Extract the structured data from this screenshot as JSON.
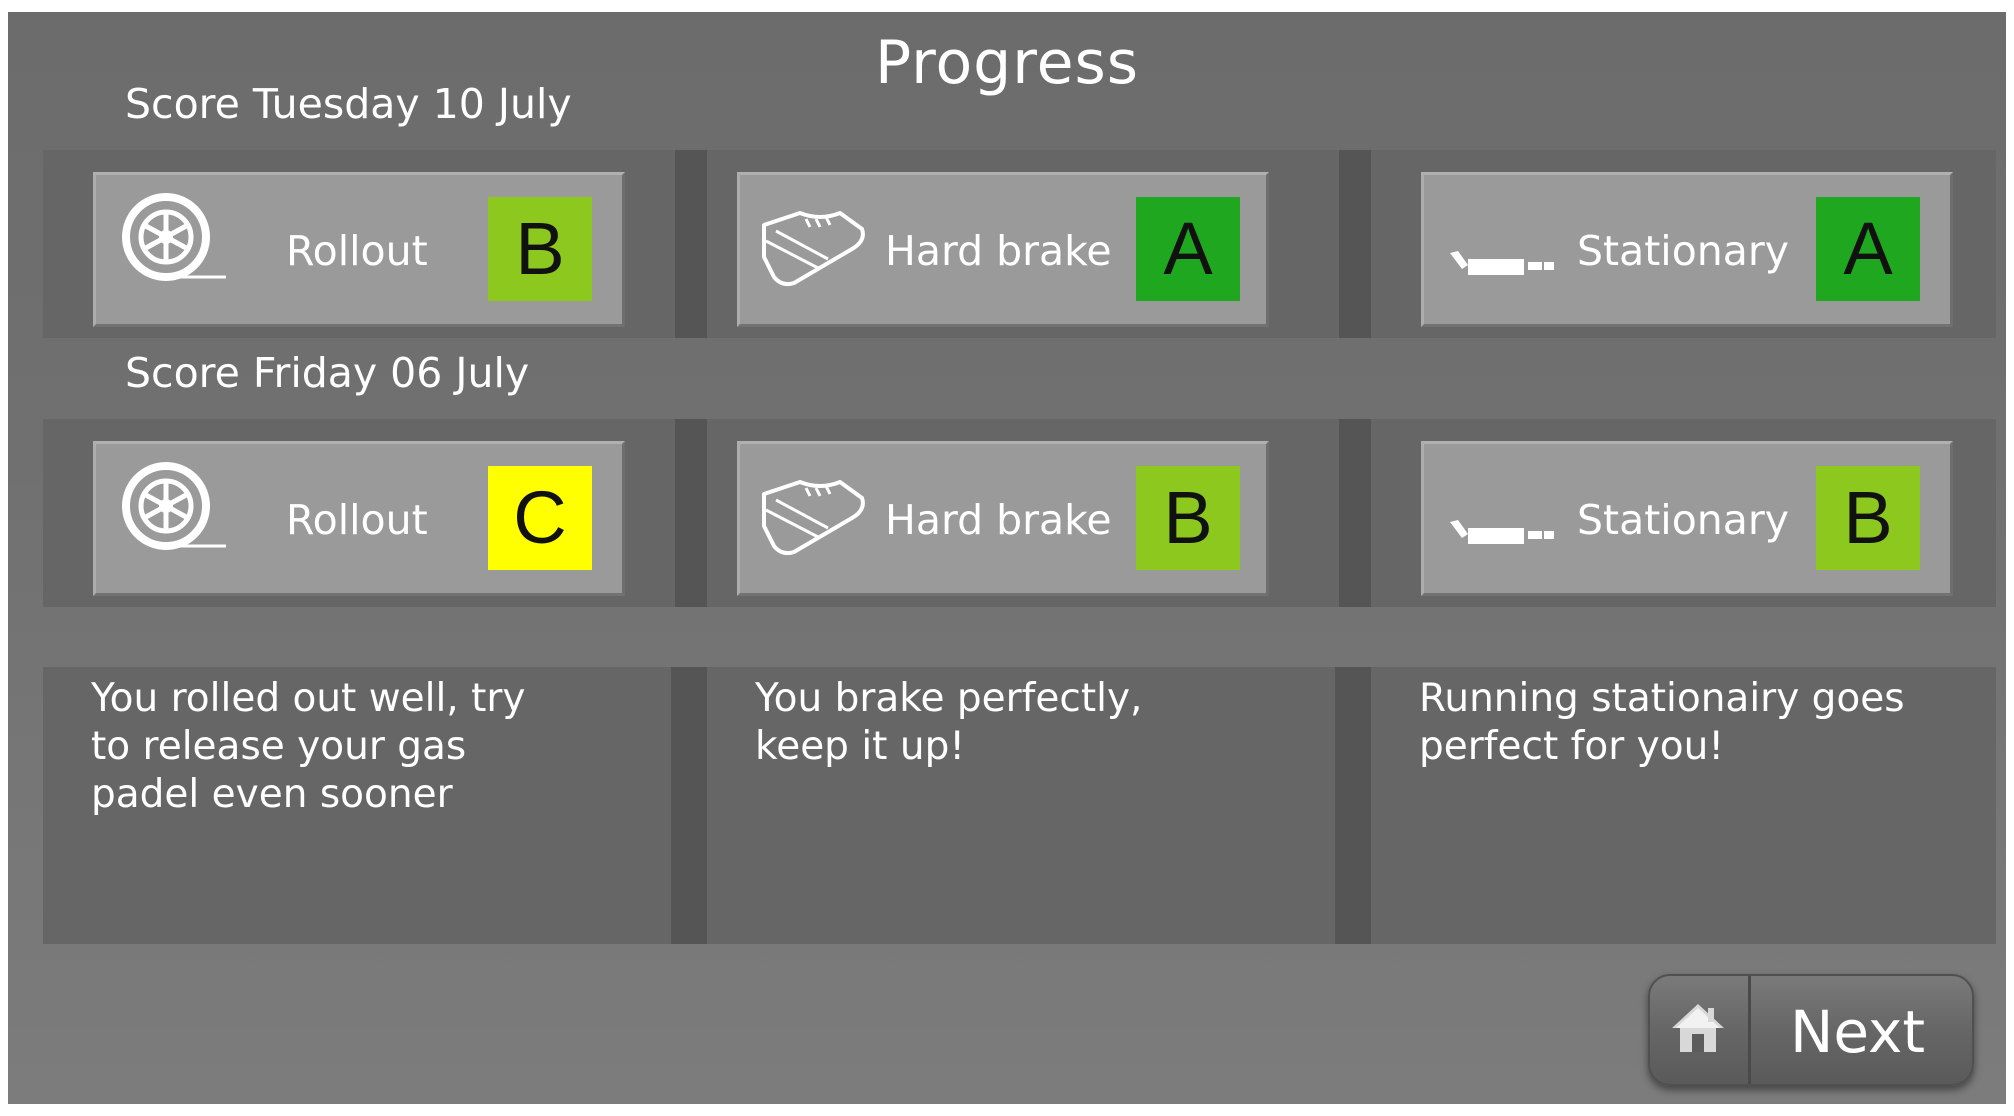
{
  "title": "Progress",
  "sessions": [
    {
      "date_label": "Score Tuesday 10 July",
      "scores": [
        {
          "name": "Rollout",
          "icon": "wheel-icon",
          "grade": "B",
          "grade_color": "#8cc81e"
        },
        {
          "name": "Hard brake",
          "icon": "shoe-icon",
          "grade": "A",
          "grade_color": "#1fa81f"
        },
        {
          "name": "Stationary",
          "icon": "exhaust-icon",
          "grade": "A",
          "grade_color": "#1fa81f"
        }
      ]
    },
    {
      "date_label": "Score Friday 06 July",
      "scores": [
        {
          "name": "Rollout",
          "icon": "wheel-icon",
          "grade": "C",
          "grade_color": "#ffff00"
        },
        {
          "name": "Hard brake",
          "icon": "shoe-icon",
          "grade": "B",
          "grade_color": "#8cc81e"
        },
        {
          "name": "Stationary",
          "icon": "exhaust-icon",
          "grade": "B",
          "grade_color": "#8cc81e"
        }
      ]
    }
  ],
  "feedback": [
    "You rolled out well, try\nto release your gas\npadel even sooner",
    "You brake perfectly,\nkeep it up!",
    "Running stationairy goes\nperfect for you!"
  ],
  "next_button": {
    "label": "Next",
    "icon": "home-icon"
  }
}
